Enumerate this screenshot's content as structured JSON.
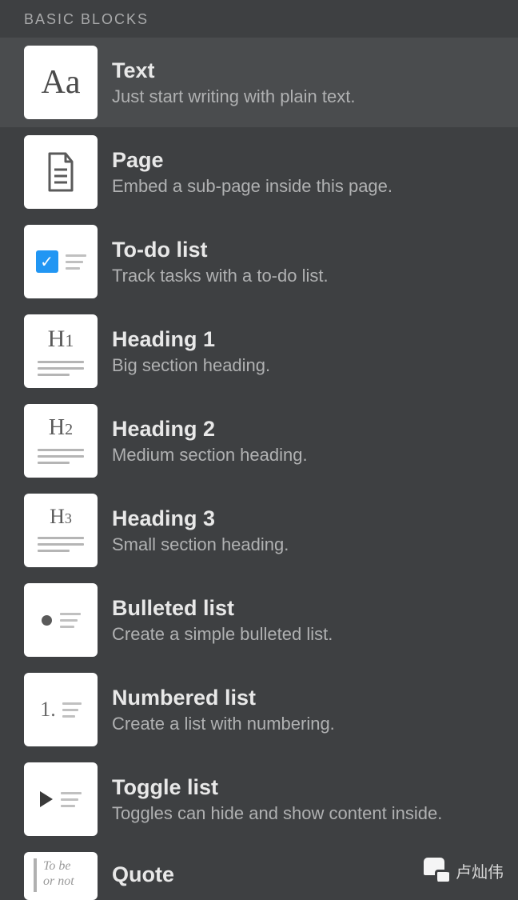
{
  "section_header": "BASIC BLOCKS",
  "items": [
    {
      "title": "Text",
      "desc": "Just start writing with plain text.",
      "icon": "text-aa"
    },
    {
      "title": "Page",
      "desc": "Embed a sub-page inside this page.",
      "icon": "page"
    },
    {
      "title": "To-do list",
      "desc": "Track tasks with a to-do list.",
      "icon": "todo"
    },
    {
      "title": "Heading 1",
      "desc": "Big section heading.",
      "icon": "h1"
    },
    {
      "title": "Heading 2",
      "desc": "Medium section heading.",
      "icon": "h2"
    },
    {
      "title": "Heading 3",
      "desc": "Small section heading.",
      "icon": "h3"
    },
    {
      "title": "Bulleted list",
      "desc": "Create a simple bulleted list.",
      "icon": "bullet"
    },
    {
      "title": "Numbered list",
      "desc": "Create a list with numbering.",
      "icon": "numbered"
    },
    {
      "title": "Toggle list",
      "desc": "Toggles can hide and show content inside.",
      "icon": "toggle"
    },
    {
      "title": "Quote",
      "desc": "",
      "icon": "quote"
    }
  ],
  "quote_icon_text": {
    "line1": "To be",
    "line2": "or not"
  },
  "watermark": {
    "label": "卢灿伟"
  }
}
